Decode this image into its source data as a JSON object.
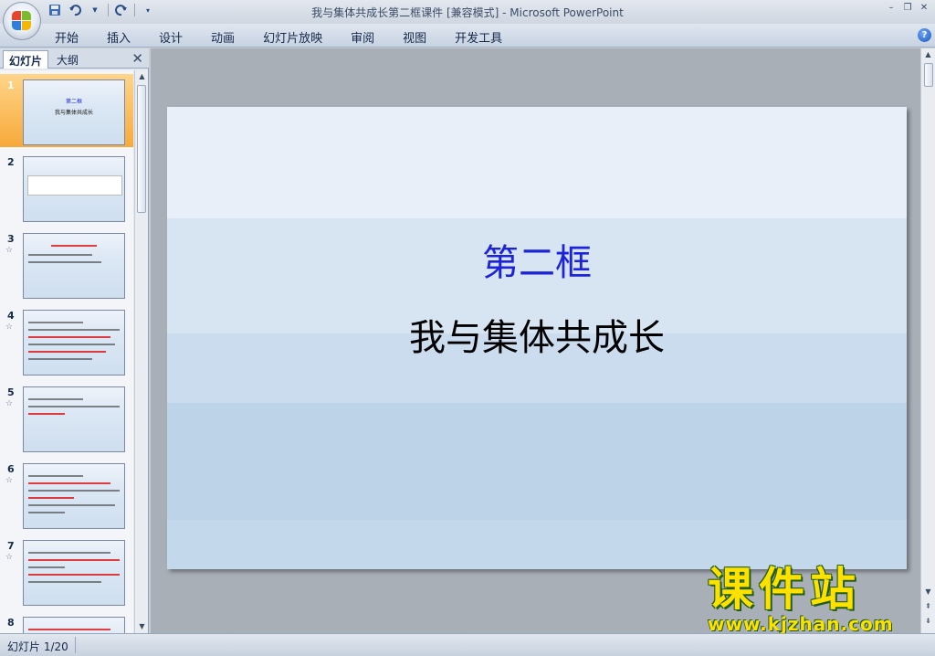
{
  "window": {
    "title": "我与集体共成长第二框课件 [兼容模式] - Microsoft PowerPoint"
  },
  "quick_access": {
    "icons": [
      "save-icon",
      "undo-icon",
      "redo-icon",
      "customize-icon"
    ]
  },
  "ribbon": {
    "tabs": [
      "开始",
      "插入",
      "设计",
      "动画",
      "幻灯片放映",
      "审阅",
      "视图",
      "开发工具"
    ]
  },
  "panel": {
    "tab_slides": "幻灯片",
    "tab_outline": "大纲",
    "close": "✕",
    "thumbnails": [
      {
        "num": "1",
        "title": "第二框",
        "subtitle": "我与集体共成长"
      },
      {
        "num": "2"
      },
      {
        "num": "3"
      },
      {
        "num": "4"
      },
      {
        "num": "5"
      },
      {
        "num": "6"
      },
      {
        "num": "7"
      },
      {
        "num": "8"
      }
    ]
  },
  "slide": {
    "title": "第二框",
    "subtitle": "我与集体共成长"
  },
  "watermark": {
    "text": "课件站",
    "url": "www.kjzhan.com"
  },
  "status": {
    "slide_counter": "幻灯片 1/20"
  },
  "colors": {
    "slide_title": "#1d23d8",
    "selected_thumb": "#f7a93a",
    "watermark": "#ffe100"
  }
}
